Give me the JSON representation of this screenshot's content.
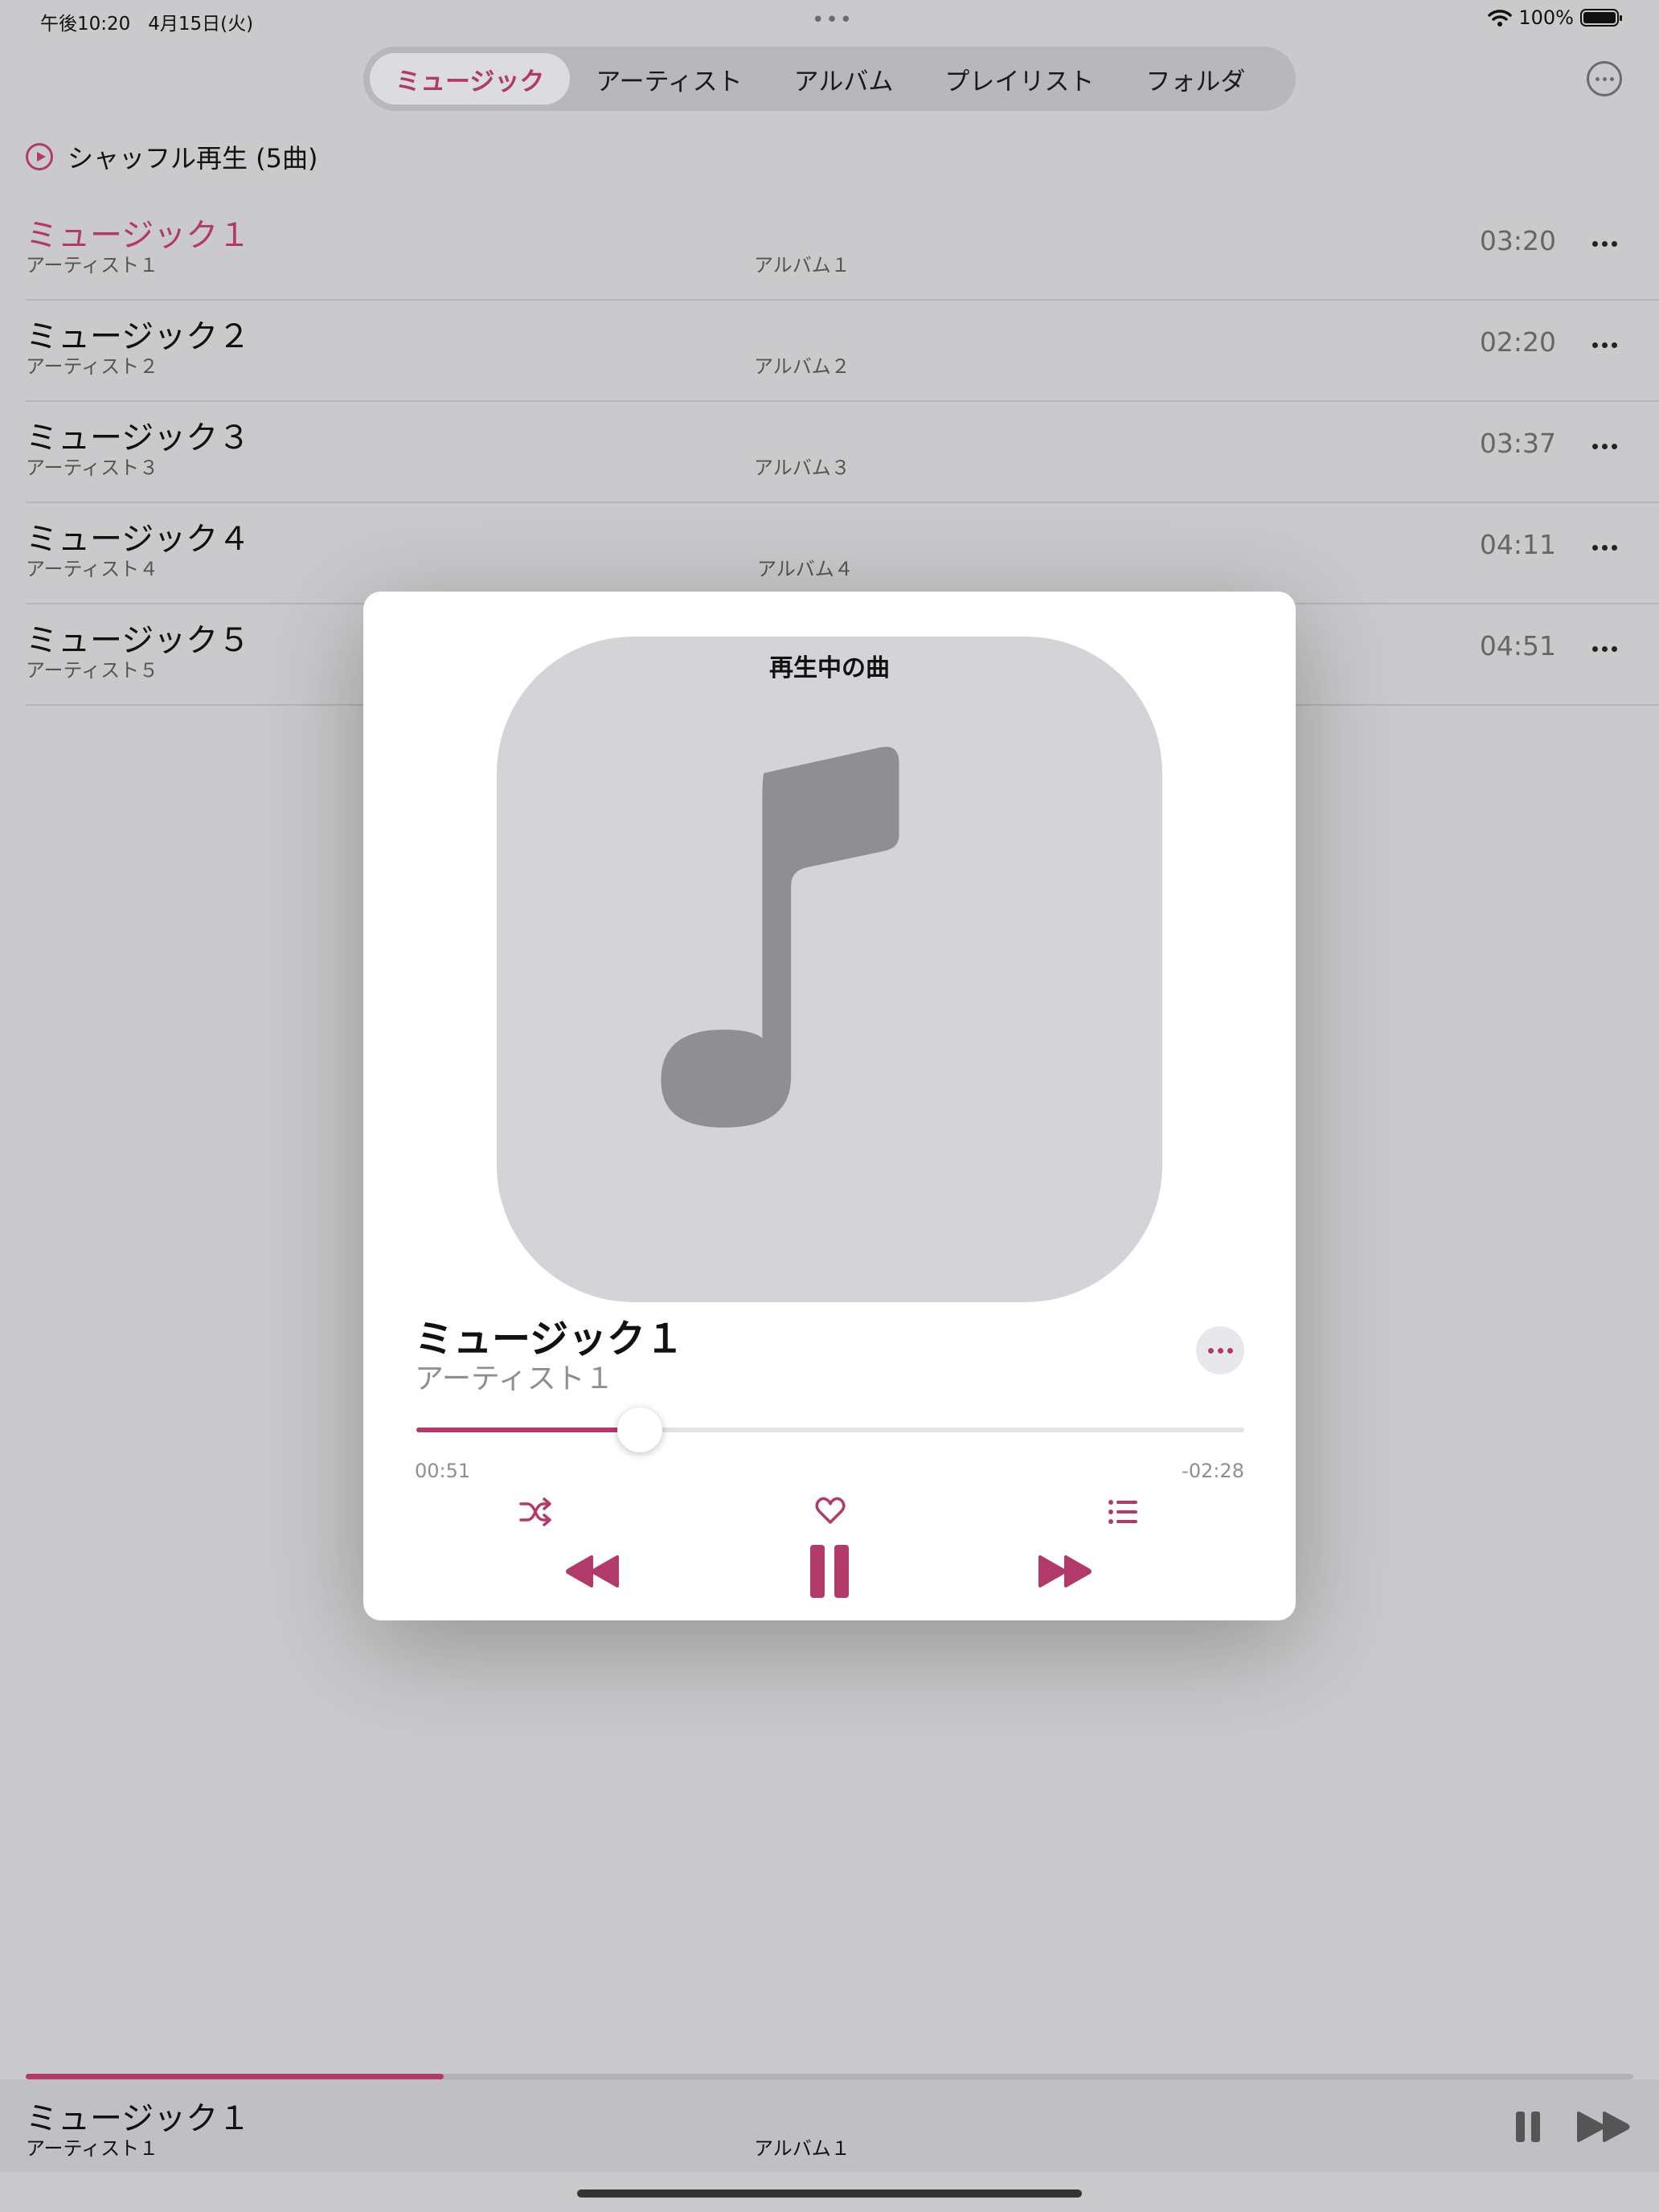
{
  "status": {
    "time": "午後10:20",
    "date": "4月15日(火)",
    "battery": "100%",
    "icons": [
      "wifi-icon",
      "battery-icon"
    ]
  },
  "tabs": [
    {
      "label": "ミュージック",
      "active": true
    },
    {
      "label": "アーティスト",
      "active": false
    },
    {
      "label": "アルバム",
      "active": false
    },
    {
      "label": "プレイリスト",
      "active": false
    },
    {
      "label": "フォルダ",
      "active": false
    }
  ],
  "shuffle": {
    "label": "シャッフル再生 (5曲)"
  },
  "songs": [
    {
      "title": "ミュージック１",
      "artist": "アーティスト１",
      "album": "アルバム１",
      "duration": "03:20",
      "playing": true
    },
    {
      "title": "ミュージック２",
      "artist": "アーティスト２",
      "album": "アルバム２",
      "duration": "02:20",
      "playing": false
    },
    {
      "title": "ミュージック３",
      "artist": "アーティスト３",
      "album": "アルバム３",
      "duration": "03:37",
      "playing": false
    },
    {
      "title": "ミュージック４",
      "artist": "アーティスト４",
      "album": "アルバム４",
      "duration": "04:11",
      "playing": false
    },
    {
      "title": "ミュージック５",
      "artist": "アーティスト５",
      "album": "",
      "duration": "04:51",
      "playing": false
    }
  ],
  "now_playing": {
    "header": "再生中の曲",
    "title": "ミュージック１",
    "artist": "アーティスト１",
    "elapsed": "00:51",
    "remaining": "-02:28",
    "progress": 0.27
  },
  "mini_player": {
    "title": "ミュージック１",
    "artist": "アーティスト１",
    "album": "アルバム１",
    "progress": 0.26
  },
  "colors": {
    "accent": "#b23a6a",
    "background": "#cacacc",
    "modal": "#ffffff",
    "artwork": "#d4d4d8",
    "note": "#8e8e93"
  }
}
